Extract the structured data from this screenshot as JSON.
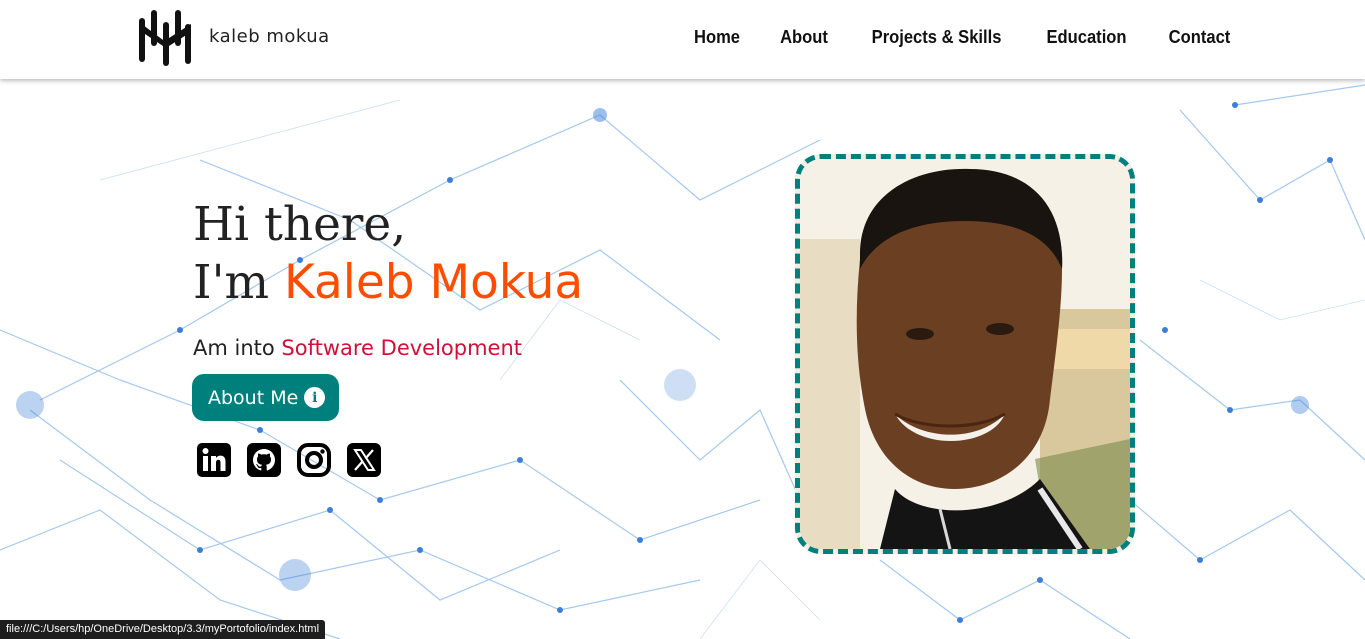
{
  "header": {
    "brand": "kaleb mokua",
    "nav": [
      "Home",
      "About",
      "Projects & Skills",
      "Education",
      "Contact"
    ]
  },
  "hero": {
    "greeting": "Hi there,",
    "intro_prefix": "I'm ",
    "name": "Kaleb Mokua",
    "tagline_prefix": "Am into ",
    "tagline_highlight": "Software Development",
    "about_button": "About Me",
    "socials": [
      "linkedin-icon",
      "github-icon",
      "instagram-icon",
      "x-icon"
    ]
  },
  "status_bar": "file:///C:/Users/hp/OneDrive/Desktop/3.3/myPortofolio/index.html",
  "colors": {
    "accent": "#00807d",
    "name": "#ff4d00",
    "highlight": "#d0103a"
  }
}
